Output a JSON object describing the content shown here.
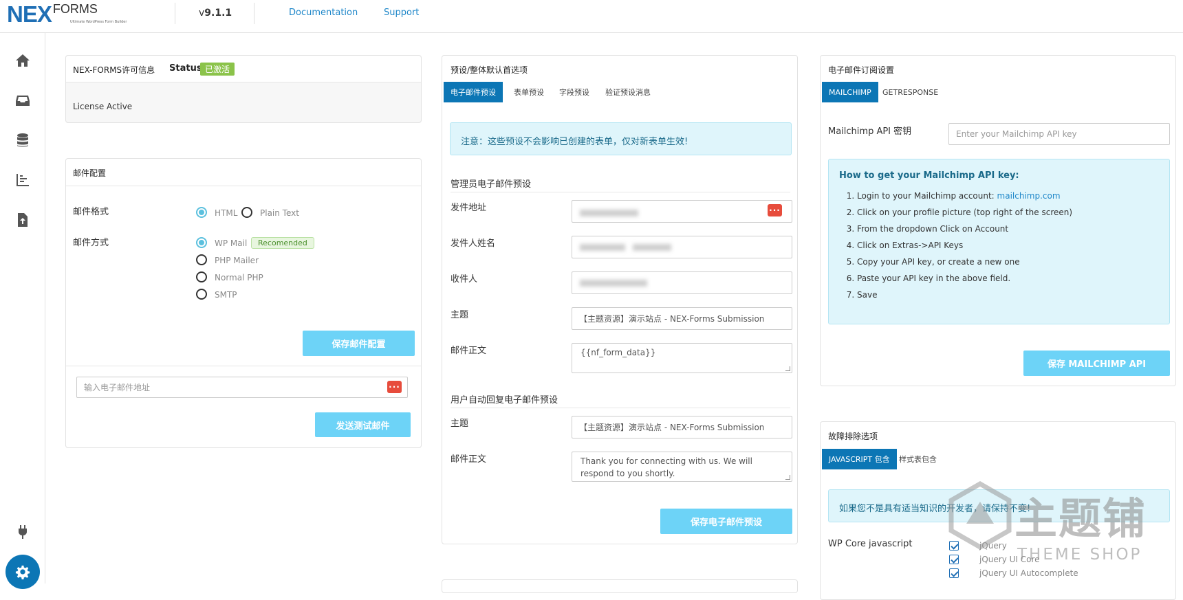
{
  "brand": {
    "name_main": "NEX",
    "name_sub": "FORMS",
    "tagline": "Ultimate WordPress Form Builder"
  },
  "header": {
    "version_prefix": "v",
    "version": "9.1.1",
    "doc_link": "Documentation",
    "support_link": "Support"
  },
  "sidebar": {
    "items": [
      "home-icon",
      "inbox-icon",
      "database-icon",
      "reports-icon",
      "file-upload-icon",
      "plug-icon",
      "gear-icon"
    ]
  },
  "license": {
    "title": "NEX-FORMS许可信息",
    "status_label": "Status:",
    "status_value": "已激活",
    "body": "License Active"
  },
  "mail_config": {
    "title": "邮件配置",
    "format_label": "邮件格式",
    "format_options": [
      "HTML",
      "Plain Text"
    ],
    "method_label": "邮件方式",
    "method_options": [
      "WP Mail",
      "PHP Mailer",
      "Normal PHP",
      "SMTP"
    ],
    "recommended_badge": "Recomended",
    "save_button": "保存邮件配置",
    "test_email_placeholder": "输入电子邮件地址",
    "send_test_button": "发送测试邮件"
  },
  "presets": {
    "title": "预设/整体默认首选项",
    "tabs": [
      "电子邮件预设",
      "表单预设",
      "字段预设",
      "验证预设消息"
    ],
    "notice": "注意：这些预设不会影响已创建的表单，仅对新表单生效!",
    "admin_section": "管理员电子邮件预设",
    "from_address_label": "发件地址",
    "from_name_label": "发件人姓名",
    "recipients_label": "收件人",
    "subject_label": "主题",
    "body_label": "邮件正文",
    "admin_subject": "【主题资源】演示站点 - NEX-Forms Submission",
    "admin_body": "{{nf_form_data}}",
    "autoresponder_section": "用户自动回复电子邮件预设",
    "user_subject_label": "主题",
    "user_body_label": "邮件正文",
    "user_subject": "【主题资源】演示站点 - NEX-Forms Submission",
    "user_body": "Thank you for connecting with us. We will respond to you shortly.",
    "save_button": "保存电子邮件预设"
  },
  "subscriptions": {
    "title": "电子邮件订阅设置",
    "tabs": [
      "MAILCHIMP",
      "GETRESPONSE"
    ],
    "api_label": "Mailchimp API 密钥",
    "api_placeholder": "Enter your Mailchimp API key",
    "howto_title": "How to get your Mailchimp API key:",
    "step1_prefix": "Login to your Mailchimp account: ",
    "step1_link": "mailchimp.com",
    "steps": [
      "Click on your profile picture (top right of the screen)",
      "From the dropdown Click on Account",
      "Click on Extras->API Keys",
      "Copy your API key, or create a new one",
      "Paste your API key in the above field.",
      "Save"
    ],
    "save_button": "保存 MAILCHIMP API"
  },
  "troubleshoot": {
    "title": "故障排除选项",
    "tabs": [
      "JAVASCRIPT 包含",
      "样式表包含"
    ],
    "notice": "如果您不是具有适当知识的开发者，请保持不变!",
    "wp_core_label": "WP Core javascript",
    "scripts": [
      "jQuery",
      "jQuery UI Core",
      "jQuery UI Autocomplete"
    ]
  },
  "watermark": {
    "main": "主题铺",
    "sub": "THEME SHOP"
  },
  "colors": {
    "accent": "#0c76b5",
    "button": "#6dd3f7",
    "status_green": "#8bc34a",
    "notice_bg": "#dff5fb",
    "danger": "#e74c3c"
  }
}
